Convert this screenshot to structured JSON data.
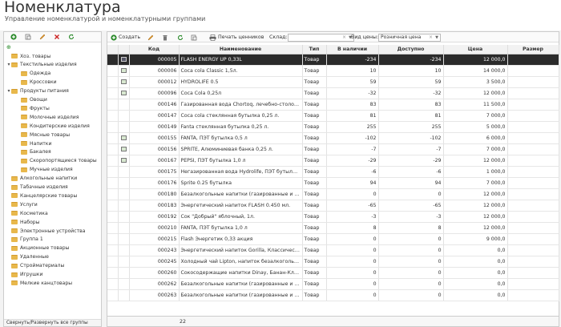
{
  "page": {
    "title": "Номенклатура",
    "subtitle": "Управление номенклатурой и номенклатурными группами"
  },
  "left_toolbar": {
    "icons": [
      "add-icon",
      "copy-icon",
      "edit-icon",
      "delete-icon",
      "refresh-icon"
    ]
  },
  "tree": {
    "items": [
      {
        "label": "Хоз. товары",
        "level": 1,
        "toggle": ""
      },
      {
        "label": "Текстильные изделия",
        "level": 1,
        "toggle": "▾"
      },
      {
        "label": "Одежда",
        "level": 2,
        "toggle": ""
      },
      {
        "label": "Кроссовки",
        "level": 2,
        "toggle": ""
      },
      {
        "label": "Продукты питания",
        "level": 1,
        "toggle": "▾"
      },
      {
        "label": "Овощи",
        "level": 2,
        "toggle": ""
      },
      {
        "label": "Фрукты",
        "level": 2,
        "toggle": ""
      },
      {
        "label": "Молочные изделия",
        "level": 2,
        "toggle": ""
      },
      {
        "label": "Кондитерские изделия",
        "level": 2,
        "toggle": ""
      },
      {
        "label": "Мясные товары",
        "level": 2,
        "toggle": ""
      },
      {
        "label": "Напитки",
        "level": 2,
        "toggle": ""
      },
      {
        "label": "Бакалея",
        "level": 2,
        "toggle": ""
      },
      {
        "label": "Скоропортящиеся товары",
        "level": 2,
        "toggle": ""
      },
      {
        "label": "Мучные изделия",
        "level": 2,
        "toggle": ""
      },
      {
        "label": "Алкогольные напитки",
        "level": 1,
        "toggle": ""
      },
      {
        "label": "Табачные изделия",
        "level": 1,
        "toggle": ""
      },
      {
        "label": "Канцелярские товары",
        "level": 1,
        "toggle": ""
      },
      {
        "label": "Услуги",
        "level": 1,
        "toggle": ""
      },
      {
        "label": "Косметика",
        "level": 1,
        "toggle": ""
      },
      {
        "label": "Наборы",
        "level": 1,
        "toggle": ""
      },
      {
        "label": "Электронные устройства",
        "level": 1,
        "toggle": ""
      },
      {
        "label": "Группа 1",
        "level": 1,
        "toggle": ""
      },
      {
        "label": "Акционные товары",
        "level": 1,
        "toggle": ""
      },
      {
        "label": "Удаленные",
        "level": 1,
        "toggle": ""
      },
      {
        "label": "Стройматериалы",
        "level": 1,
        "toggle": ""
      },
      {
        "label": "Игрушки",
        "level": 1,
        "toggle": ""
      },
      {
        "label": "Мелкие канцтовары",
        "level": 1,
        "toggle": ""
      }
    ],
    "footer": "Свернуть/Развернуть все группы"
  },
  "main_toolbar": {
    "create_label": "Создать",
    "print_label": "Печать ценников",
    "warehouse_label": "Склад:",
    "warehouse_value": "",
    "price_type_label": "Вид цены:",
    "price_type_value": "Розничная цена"
  },
  "grid": {
    "columns": [
      "",
      "",
      "Код",
      "Наименование",
      "Тип",
      "В наличии",
      "Доступно",
      "Цена",
      "Размер"
    ],
    "rows": [
      {
        "img": true,
        "code": "000005",
        "name": "FLASH ENERGY UP 0,33L",
        "type": "Товар",
        "stock": "-234",
        "available": "-234",
        "price": "12 000,0",
        "size": "",
        "selected": true
      },
      {
        "img": true,
        "code": "000006",
        "name": "Coca cola Classic 1,5л.",
        "type": "Товар",
        "stock": "10",
        "available": "10",
        "price": "14 000,0",
        "size": ""
      },
      {
        "img": true,
        "code": "000012",
        "name": "HYDROLIFE 0.5",
        "type": "Товар",
        "stock": "59",
        "available": "59",
        "price": "3 500,0",
        "size": ""
      },
      {
        "img": true,
        "code": "000096",
        "name": "Coca Cola 0,25л",
        "type": "Товар",
        "stock": "-32",
        "available": "-32",
        "price": "12 000,0",
        "size": ""
      },
      {
        "img": false,
        "code": "000146",
        "name": "Газированная вода Chortoq, лечебно-столовое с...",
        "type": "Товар",
        "stock": "83",
        "available": "83",
        "price": "11 500,0",
        "size": ""
      },
      {
        "img": false,
        "code": "000147",
        "name": "Coca cola стеклянная бутылка 0,25 л.",
        "type": "Товар",
        "stock": "81",
        "available": "81",
        "price": "7 000,0",
        "size": ""
      },
      {
        "img": false,
        "code": "000149",
        "name": "Fanta стеклянная бутылка 0,25 л.",
        "type": "Товар",
        "stock": "255",
        "available": "255",
        "price": "5 000,0",
        "size": ""
      },
      {
        "img": true,
        "code": "000155",
        "name": "FANTA, ПЭТ бутылка 0,5 л",
        "type": "Товар",
        "stock": "-102",
        "available": "-102",
        "price": "6 000,0",
        "size": ""
      },
      {
        "img": true,
        "code": "000156",
        "name": "SPRITE, Алюминиевая банка 0,25 л.",
        "type": "Товар",
        "stock": "-7",
        "available": "-7",
        "price": "7 000,0",
        "size": ""
      },
      {
        "img": true,
        "code": "000167",
        "name": "PEPSI, ПЭТ бутылка 1,0 л",
        "type": "Товар",
        "stock": "-29",
        "available": "-29",
        "price": "12 000,0",
        "size": ""
      },
      {
        "img": false,
        "code": "000175",
        "name": "Негазированная вода Hydrolife, ПЭТ бутылка 0,5 л",
        "type": "Товар",
        "stock": "-6",
        "available": "-6",
        "price": "1 000,0",
        "size": ""
      },
      {
        "img": false,
        "code": "000176",
        "name": "Sprite 0.25 бутылка",
        "type": "Товар",
        "stock": "94",
        "available": "94",
        "price": "7 000,0",
        "size": ""
      },
      {
        "img": false,
        "code": "000180",
        "name": "Безалкогольные напитки (газированные и негаз...",
        "type": "Товар",
        "stock": "0",
        "available": "0",
        "price": "12 000,0",
        "size": ""
      },
      {
        "img": false,
        "code": "000183",
        "name": "Энергетический напиток FLASH 0.450 мл.",
        "type": "Товар",
        "stock": "-65",
        "available": "-65",
        "price": "12 000,0",
        "size": ""
      },
      {
        "img": false,
        "code": "000192",
        "name": "Сок \"Добрый\" яблочный, 1л.",
        "type": "Товар",
        "stock": "-3",
        "available": "-3",
        "price": "12 000,0",
        "size": ""
      },
      {
        "img": false,
        "code": "000210",
        "name": "FANTA, ПЭТ бутылка 1,0 л",
        "type": "Товар",
        "stock": "8",
        "available": "8",
        "price": "12 000,0",
        "size": ""
      },
      {
        "img": false,
        "code": "000215",
        "name": "Flash Энергетик 0,33 акция",
        "type": "Товар",
        "stock": "0",
        "available": "0",
        "price": "9 000,0",
        "size": ""
      },
      {
        "img": false,
        "code": "000243",
        "name": "Энергетический напиток Gorilla, Классическая б...",
        "type": "Товар",
        "stock": "0",
        "available": "0",
        "price": "0,0",
        "size": ""
      },
      {
        "img": false,
        "code": "000245",
        "name": "Холодный чай Lipton, напиток безалкогольный ...",
        "type": "Товар",
        "stock": "0",
        "available": "0",
        "price": "0,0",
        "size": ""
      },
      {
        "img": false,
        "code": "000260",
        "name": "Сокосодержащие напитки Dinay, Банан-Клубник...",
        "type": "Товар",
        "stock": "0",
        "available": "0",
        "price": "0,0",
        "size": ""
      },
      {
        "img": false,
        "code": "000262",
        "name": "Безалкогольные напитки (газированные и негаз...",
        "type": "Товар",
        "stock": "0",
        "available": "0",
        "price": "0,0",
        "size": ""
      },
      {
        "img": false,
        "code": "000263",
        "name": "Безалкогольные напитки (газированные и негаз...",
        "type": "Товар",
        "stock": "0",
        "available": "0",
        "price": "0,0",
        "size": ""
      }
    ],
    "footer_count": "22"
  },
  "colors": {
    "selected_row": "#2b2b2b",
    "folder": "#e8b84c",
    "add_green": "#2a8a2a",
    "delete_red": "#cc2222"
  }
}
